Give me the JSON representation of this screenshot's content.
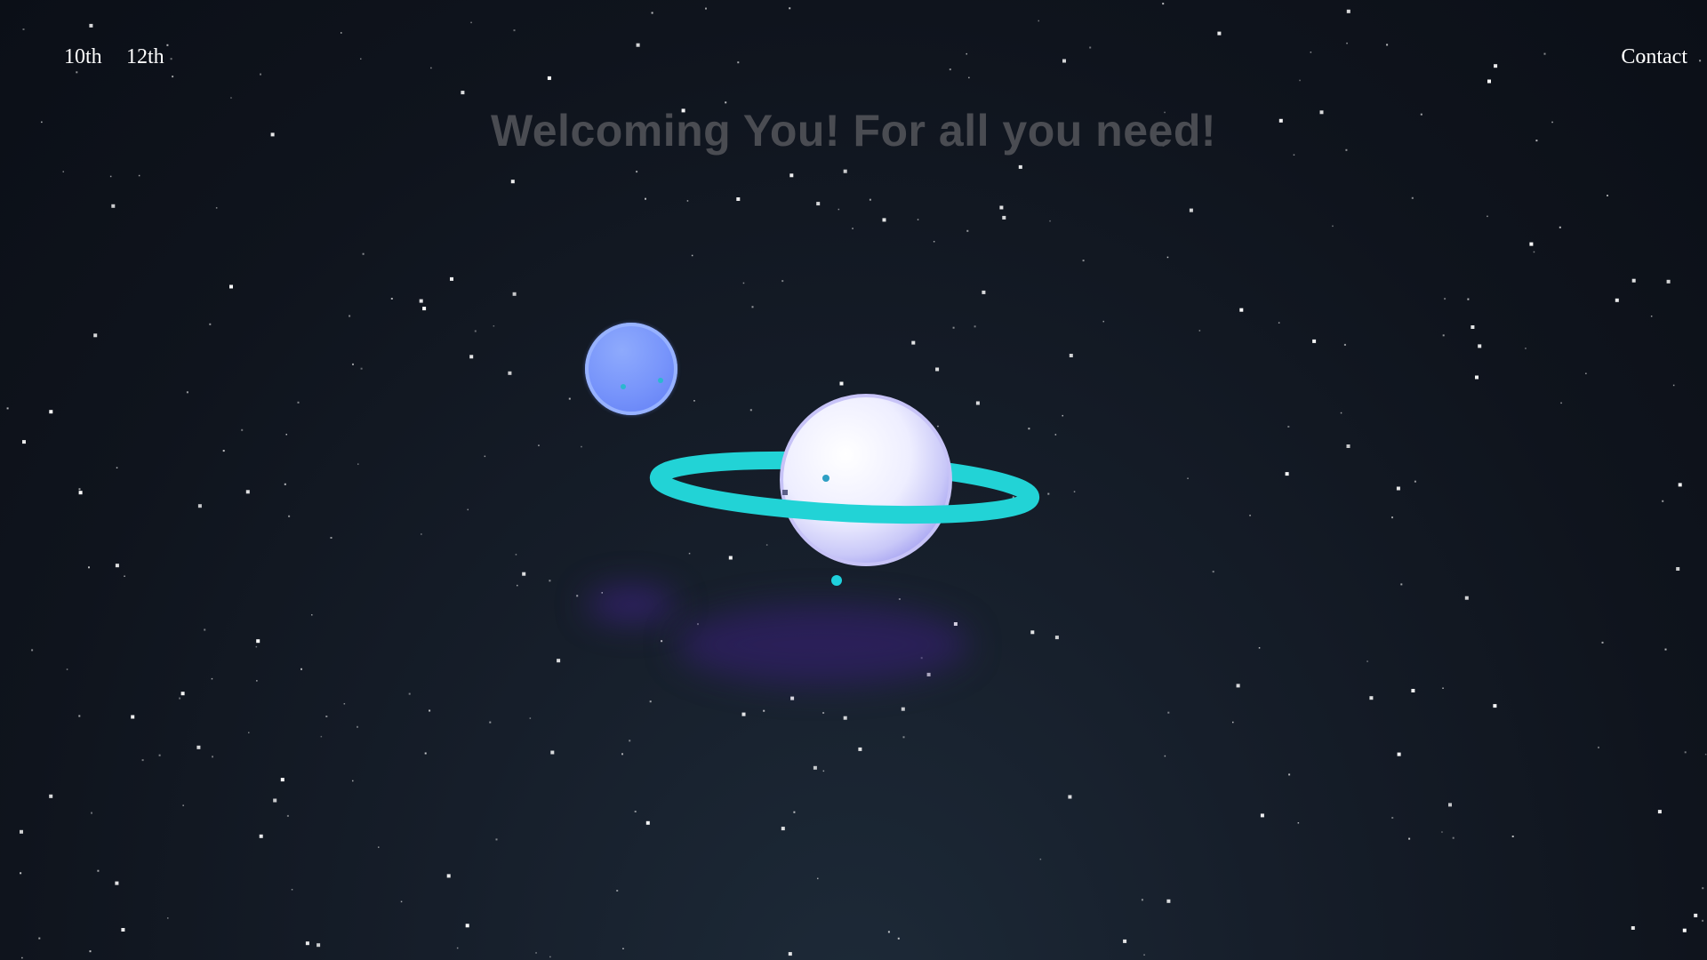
{
  "nav": {
    "left_links": [
      "10th",
      "12th"
    ],
    "right_link": "Contact"
  },
  "hero": {
    "headline": "Welcoming You! For all you need!"
  },
  "colors": {
    "background_top": "#0b0f17",
    "background_bottom": "#1d2a38",
    "nav_text": "#ffffff",
    "headline_text": "#4a4c52",
    "ring": "#22d3d6",
    "big_planet": "#f4f3ff",
    "small_planet": "#7895fb",
    "glow": "#3a1f7a"
  },
  "icons": {
    "ringed_planet": "ringed-planet-illustration",
    "moon": "blue-moon-illustration"
  }
}
